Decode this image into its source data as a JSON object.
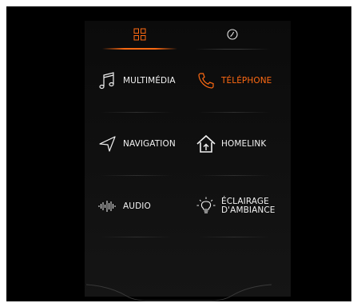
{
  "tabs": [
    {
      "icon": "grid-icon",
      "active": true
    },
    {
      "icon": "clock-icon",
      "active": false
    }
  ],
  "menu": {
    "items": [
      {
        "id": "multimedia",
        "label": "MULTIMÉDIA",
        "icon": "music-note-icon",
        "active": false
      },
      {
        "id": "telephone",
        "label": "TÉLÉPHONE",
        "icon": "phone-icon",
        "active": true
      },
      {
        "id": "navigation",
        "label": "NAVIGATION",
        "icon": "navigation-arrow-icon",
        "active": false
      },
      {
        "id": "homelink",
        "label": "HOMELINK",
        "icon": "home-icon",
        "active": false
      },
      {
        "id": "audio",
        "label": "AUDIO",
        "icon": "sound-wave-icon",
        "active": false
      },
      {
        "id": "eclairage",
        "label_line1": "ÉCLAIRAGE",
        "label_line2": "D'AMBIANCE",
        "icon": "light-bulb-icon",
        "active": false
      }
    ]
  },
  "colors": {
    "accent": "#ff6a13",
    "text": "#f2f2f2",
    "background": "#000000"
  }
}
